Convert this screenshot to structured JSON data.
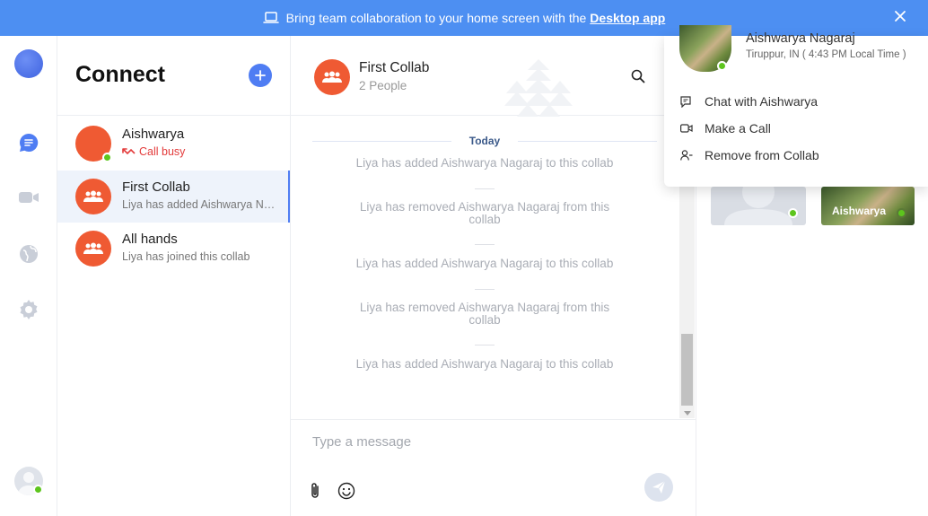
{
  "banner": {
    "text": "Bring team collaboration to your home screen with the",
    "link": "Desktop app"
  },
  "sidebar": {
    "title": "Connect"
  },
  "conversations": [
    {
      "name": "Aishwarya",
      "status": "Call busy"
    },
    {
      "name": "First Collab",
      "preview": "Liya has added Aishwarya Nagaraj to this collab"
    },
    {
      "name": "All hands",
      "preview": "Liya has joined this collab"
    }
  ],
  "chat": {
    "title": "First Collab",
    "subtitle": "2 People",
    "date_divider": "Today",
    "messages": [
      "Liya has added Aishwarya Nagaraj to this collab",
      "Liya has removed Aishwarya Nagaraj from this collab",
      "Liya has added Aishwarya Nagaraj to this collab",
      "Liya has removed Aishwarya Nagaraj from this collab",
      "Liya has added Aishwarya Nagaraj to this collab"
    ],
    "composer_placeholder": "Type a message"
  },
  "participants": [
    {
      "name": ""
    },
    {
      "name": "Aishwarya"
    }
  ],
  "profile_popup": {
    "name": "Aishwarya Nagaraj",
    "location": "Tiruppur, IN ( 4:43 PM Local Time )",
    "actions": [
      "Chat with Aishwarya",
      "Make a Call",
      "Remove from Collab"
    ]
  },
  "colors": {
    "banner": "#4d8ff2",
    "accent": "#4f7df3",
    "group_avatar": "#ef5a33",
    "online": "#5dc51d",
    "busy": "#e33b3b"
  }
}
